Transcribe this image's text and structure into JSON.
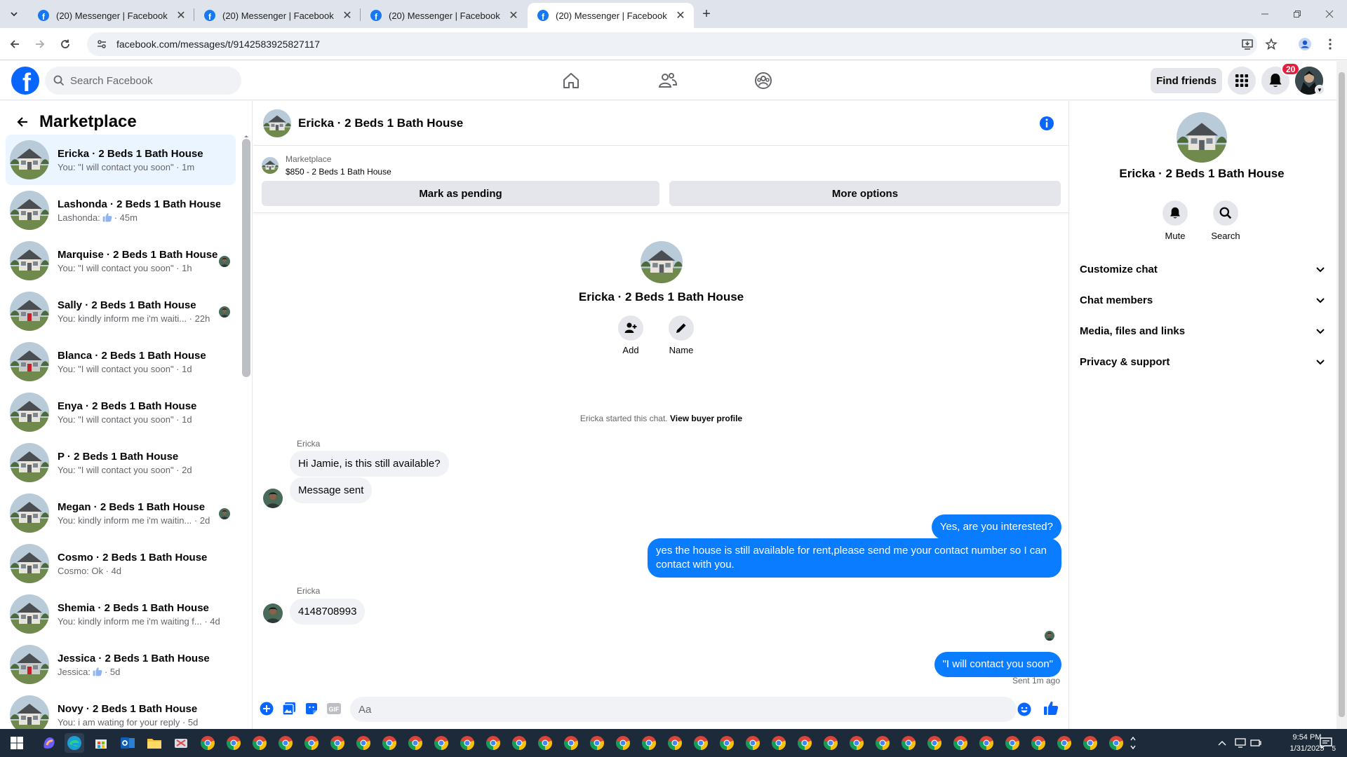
{
  "browser": {
    "tabs": [
      {
        "title": "(20) Messenger | Facebook",
        "active": false
      },
      {
        "title": "(20) Messenger | Facebook",
        "active": false
      },
      {
        "title": "(20) Messenger | Facebook",
        "active": false
      },
      {
        "title": "(20) Messenger | Facebook",
        "active": true
      }
    ],
    "url": "facebook.com/messages/t/9142583925827117"
  },
  "fbnav": {
    "search_placeholder": "Search Facebook",
    "find_friends": "Find friends",
    "notification_count": "20"
  },
  "sidebar": {
    "title": "Marketplace",
    "conversations": [
      {
        "name": "Ericka · 2 Beds 1 Bath House",
        "snippet": "You: \"I will contact you soon\" · 1m",
        "active": true,
        "read": false
      },
      {
        "name": "Lashonda · 2 Beds 1 Bath House",
        "prefix": "Lashonda:",
        "thumb": true,
        "time": "· 45m",
        "read": false
      },
      {
        "name": "Marquise · 2 Beds 1 Bath House",
        "snippet": "You: \"I will contact you soon\" · 1h",
        "read": true
      },
      {
        "name": "Sally · 2 Beds 1 Bath House",
        "snippet": "You: kindly inform me i'm waiti... · 22h",
        "read": true
      },
      {
        "name": "Blanca · 2 Beds 1 Bath House",
        "snippet": "You: \"I will contact you soon\" · 1d",
        "read": false
      },
      {
        "name": "Enya · 2 Beds 1 Bath House",
        "snippet": "You: \"I will contact you soon\" · 1d",
        "read": false
      },
      {
        "name": "P · 2 Beds 1 Bath House",
        "snippet": "You: \"I will contact you soon\" · 2d",
        "read": false
      },
      {
        "name": "Megan · 2 Beds 1 Bath House",
        "snippet": "You: kindly inform me i'm waitin... · 2d",
        "read": true
      },
      {
        "name": "Cosmo · 2 Beds 1 Bath House",
        "snippet": "Cosmo: Ok · 4d",
        "read": false
      },
      {
        "name": "Shemia · 2 Beds 1 Bath House",
        "snippet": "You: kindly inform me i'm waiting f... · 4d",
        "read": false
      },
      {
        "name": "Jessica · 2 Beds 1 Bath House",
        "prefix": "Jessica:",
        "thumb": true,
        "time": "· 5d",
        "read": false
      },
      {
        "name": "Novy · 2 Beds 1 Bath House",
        "snippet": "You: i am wating for your reply · 5d",
        "read": false
      }
    ]
  },
  "chat": {
    "title": "Ericka · 2 Beds 1 Bath House",
    "marketplace_label": "Marketplace",
    "listing": "$850 - 2 Beds 1 Bath House",
    "mark_pending": "Mark as pending",
    "more_options": "More options",
    "intro_name": "Ericka · 2 Beds 1 Bath House",
    "add_label": "Add",
    "name_label": "Name",
    "started_text": "Ericka started this chat.",
    "view_buyer": "View buyer profile",
    "sender": "Ericka",
    "messages": {
      "m1": "Hi Jamie, is this still available?",
      "m2": "Message sent",
      "m3": "Yes, are you interested?",
      "m4": "yes the house is still available for rent,please send me your contact number so I can contact with you.",
      "m5": "4148708993",
      "m6": "\"I will contact you soon\""
    },
    "sent_time": "Sent 1m ago",
    "composer_placeholder": "Aa"
  },
  "info_panel": {
    "name": "Ericka · 2 Beds 1 Bath House",
    "mute": "Mute",
    "search": "Search",
    "sections": [
      "Customize chat",
      "Chat members",
      "Media, files and links",
      "Privacy & support"
    ]
  },
  "taskbar": {
    "time": "9:54 PM",
    "date": "1/31/2025",
    "notification_count": "5"
  },
  "colors": {
    "accent": "#0866ff",
    "outgoing_bubble": "#0a7cff",
    "incoming_bubble": "#f0f2f5",
    "notification": "#e41e3f"
  }
}
